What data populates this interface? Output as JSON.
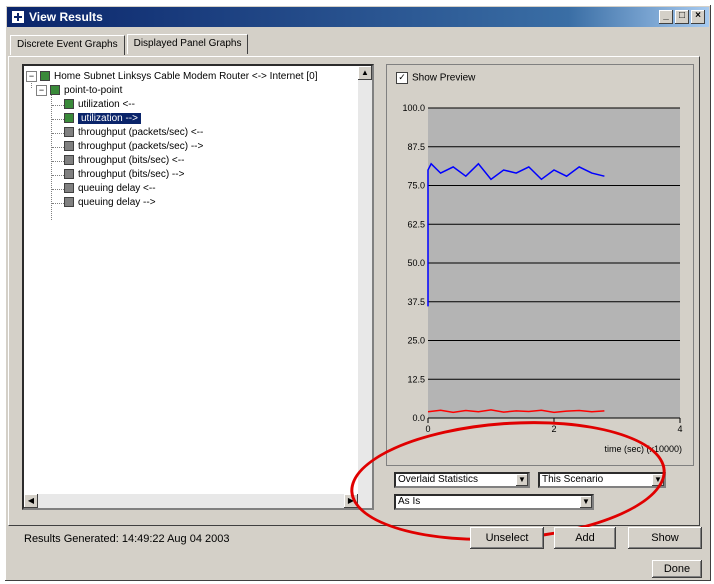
{
  "window": {
    "title": "View Results"
  },
  "tabs": [
    {
      "label": "Discrete Event Graphs",
      "active": true
    },
    {
      "label": "Displayed Panel Graphs",
      "active": false
    }
  ],
  "tree": {
    "root": "Home Subnet Linksys Cable Modem Router <-> Internet [0]",
    "group": "point-to-point",
    "items": [
      {
        "label": "utilization <--",
        "selected": false,
        "checked": true
      },
      {
        "label": "utilization -->",
        "selected": true,
        "checked": true
      },
      {
        "label": "throughput (packets/sec) <--",
        "selected": false,
        "checked": false
      },
      {
        "label": "throughput (packets/sec) -->",
        "selected": false,
        "checked": false
      },
      {
        "label": "throughput (bits/sec) <--",
        "selected": false,
        "checked": false
      },
      {
        "label": "throughput (bits/sec) -->",
        "selected": false,
        "checked": false
      },
      {
        "label": "queuing delay <--",
        "selected": false,
        "checked": false
      },
      {
        "label": "queuing delay -->",
        "selected": false,
        "checked": false
      }
    ]
  },
  "preview": {
    "show_preview_label": "Show Preview",
    "checked": true
  },
  "chart_data": {
    "type": "line",
    "xlabel": "time (sec) (x10000)",
    "xlim": [
      0,
      4
    ],
    "ylim": [
      0,
      100
    ],
    "xticks": [
      "0",
      "2",
      "4"
    ],
    "yticks": [
      "100.0",
      "87.5",
      "75.0",
      "62.5",
      "50.0",
      "37.5",
      "25.0",
      "12.5",
      "0.0"
    ],
    "grid": true,
    "series": [
      {
        "color": "#0000ff",
        "x": [
          0,
          0,
          0.05,
          0.2,
          0.4,
          0.6,
          0.8,
          1.0,
          1.2,
          1.4,
          1.6,
          1.8,
          2.0,
          2.2,
          2.4,
          2.6,
          2.8
        ],
        "y": [
          36,
          80,
          82,
          79,
          81,
          78,
          82,
          77,
          80,
          79,
          81,
          77,
          80,
          78,
          81,
          79,
          78
        ]
      },
      {
        "color": "#ff0000",
        "x": [
          0.0,
          0.2,
          0.4,
          0.6,
          0.8,
          1.0,
          1.2,
          1.4,
          1.6,
          1.8,
          2.0,
          2.2,
          2.4,
          2.6,
          2.8
        ],
        "y": [
          2.0,
          2.5,
          1.8,
          2.4,
          2.0,
          2.6,
          1.9,
          2.3,
          2.1,
          2.5,
          1.8,
          2.2,
          2.4,
          2.0,
          2.3
        ]
      }
    ]
  },
  "controls": {
    "stat_mode": "Overlaid Statistics",
    "scenario": "This Scenario",
    "filter": "As Is"
  },
  "buttons": {
    "unselect": "Unselect",
    "add": "Add",
    "show": "Show",
    "done": "Done"
  },
  "status": "Results Generated: 14:49:22 Aug 04 2003",
  "annotation_color": "#e00000"
}
